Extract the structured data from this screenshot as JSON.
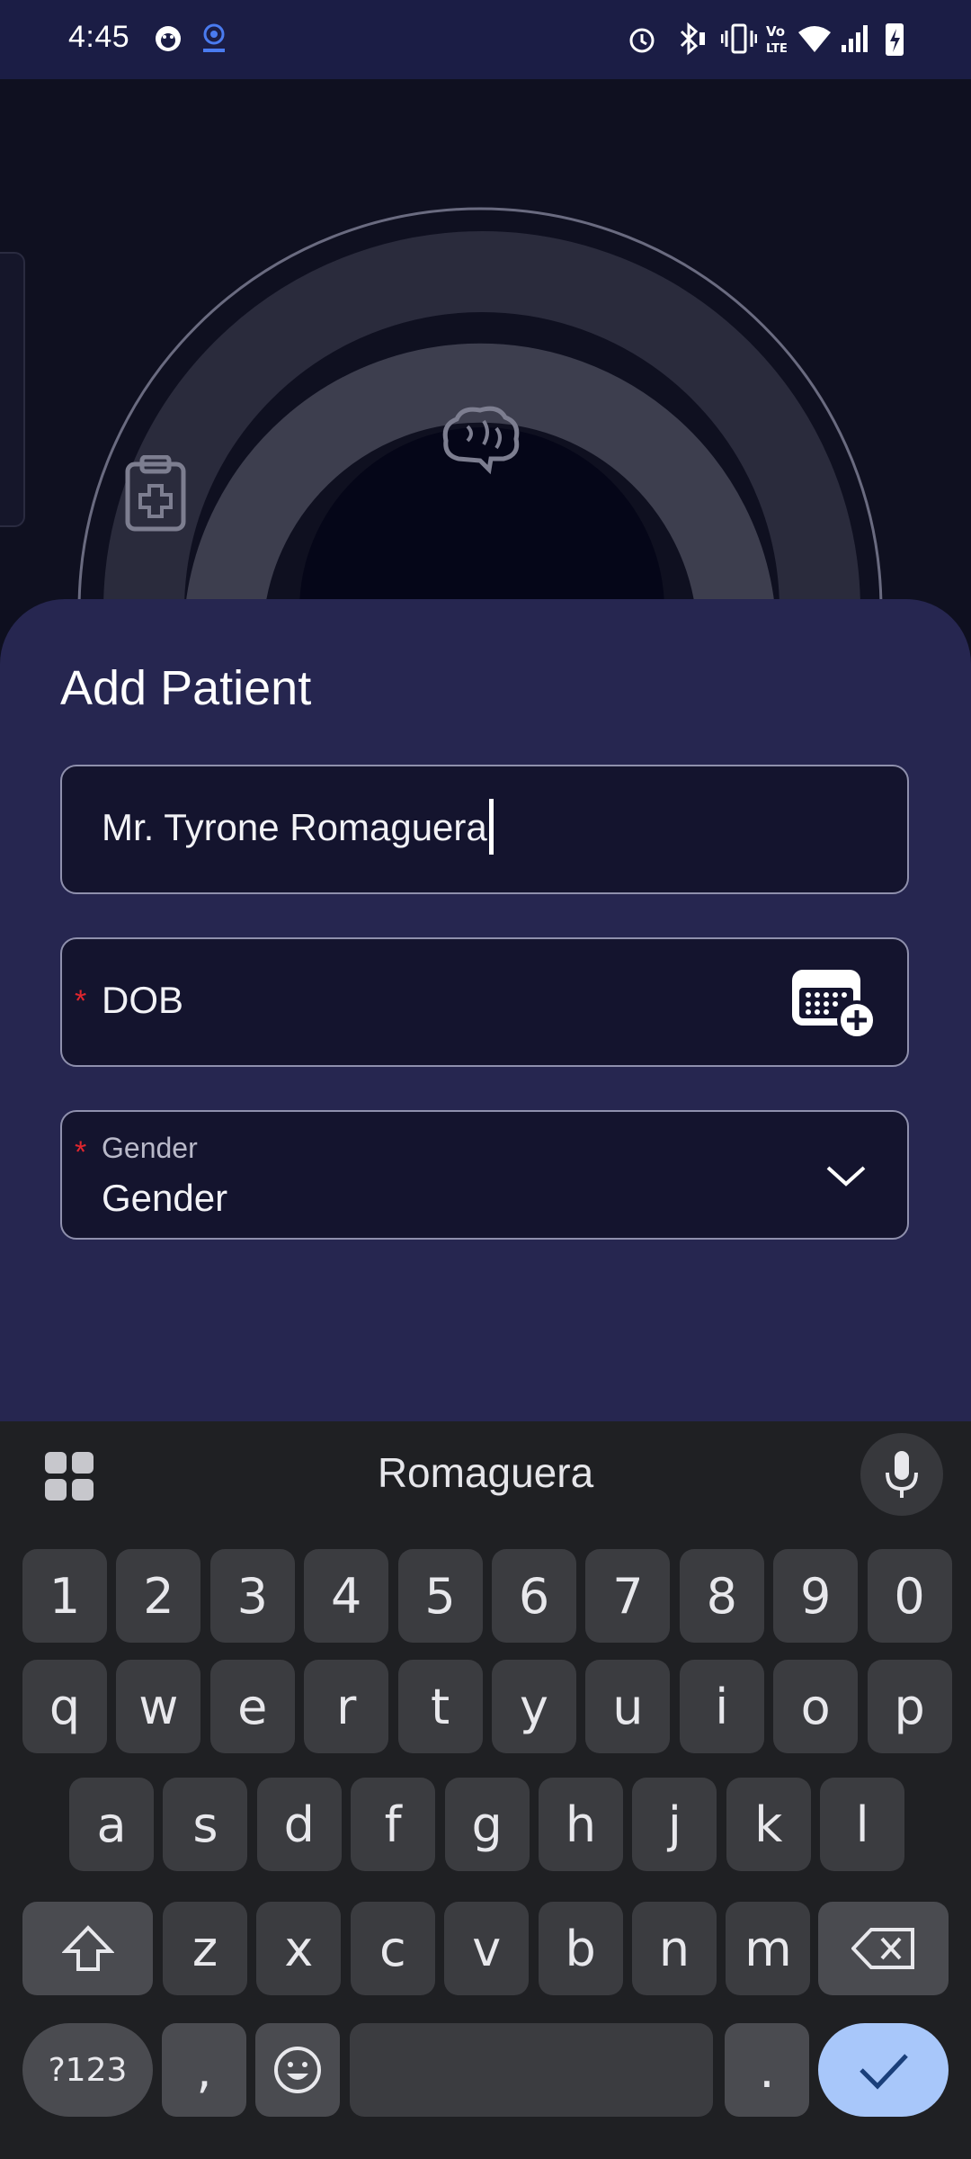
{
  "status_bar": {
    "time": "4:45"
  },
  "sheet": {
    "title": "Add Patient",
    "name_field": {
      "value": "Mr. Tyrone Romaguera"
    },
    "dob_field": {
      "required_mark": "*",
      "placeholder": "DOB"
    },
    "gender_field": {
      "required_mark": "*",
      "label": "Gender",
      "value": "Gender"
    }
  },
  "keyboard": {
    "suggestion": "Romaguera",
    "rows": [
      [
        "1",
        "2",
        "3",
        "4",
        "5",
        "6",
        "7",
        "8",
        "9",
        "0"
      ],
      [
        "q",
        "w",
        "e",
        "r",
        "t",
        "y",
        "u",
        "i",
        "o",
        "p"
      ],
      [
        "a",
        "s",
        "d",
        "f",
        "g",
        "h",
        "j",
        "k",
        "l"
      ],
      [
        "z",
        "x",
        "c",
        "v",
        "b",
        "n",
        "m"
      ]
    ],
    "symbols_label": "?123",
    "comma_label": ",",
    "period_label": "."
  },
  "colors": {
    "status_bar": "#1b1d45",
    "sheet": "#262650",
    "field_bg": "#14142e",
    "done_key": "#a8c7fa"
  }
}
